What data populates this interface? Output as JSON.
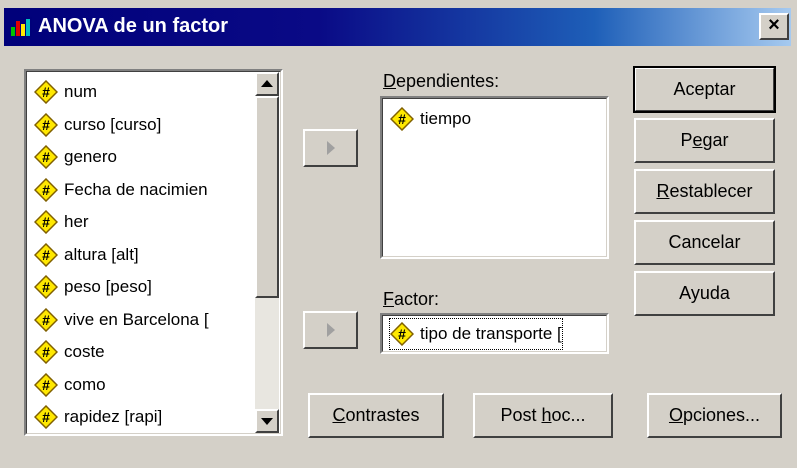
{
  "window": {
    "title": "ANOVA de un factor",
    "close_glyph": "×"
  },
  "variables": [
    {
      "label": "num",
      "icon": "numeric-variable-icon"
    },
    {
      "label": "curso [curso]",
      "icon": "numeric-variable-icon"
    },
    {
      "label": "genero",
      "icon": "numeric-variable-icon"
    },
    {
      "label": "Fecha de nacimien",
      "icon": "numeric-variable-icon"
    },
    {
      "label": "her",
      "icon": "numeric-variable-icon"
    },
    {
      "label": "altura [alt]",
      "icon": "numeric-variable-icon"
    },
    {
      "label": "peso [peso]",
      "icon": "numeric-variable-icon"
    },
    {
      "label": "vive en Barcelona [",
      "icon": "numeric-variable-icon"
    },
    {
      "label": "coste",
      "icon": "numeric-variable-icon"
    },
    {
      "label": "como",
      "icon": "numeric-variable-icon"
    },
    {
      "label": "rapidez [rapi]",
      "icon": "numeric-variable-icon"
    }
  ],
  "dependientes": {
    "label": "Dependientes:",
    "items": [
      {
        "label": "tiempo",
        "icon": "numeric-variable-icon"
      }
    ]
  },
  "factor": {
    "label": "Factor:",
    "value": "tipo de transporte [",
    "icon": "numeric-variable-icon"
  },
  "buttons": {
    "aceptar": "Aceptar",
    "pegar": "Pegar",
    "restablecer": "Restablecer",
    "cancelar": "Cancelar",
    "ayuda": "Ayuda",
    "contrastes": "Contrastes",
    "post_hoc": "Post hoc...",
    "opciones": "Opciones..."
  },
  "colors": {
    "title_start": "#00007a",
    "title_end": "#a6caf0",
    "face": "#d4d0c8",
    "icon_yellow": "#ffe800"
  }
}
